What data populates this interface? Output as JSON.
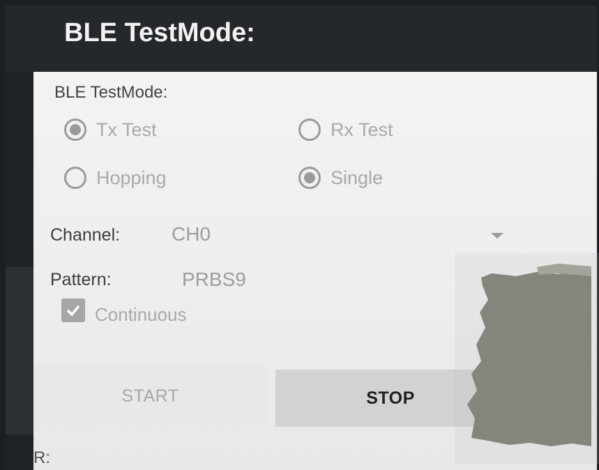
{
  "actionbar": {
    "title": "BLE TestMode:"
  },
  "panel": {
    "section_label": "BLE TestMode:"
  },
  "radios": {
    "tx_test": {
      "label": "Tx Test",
      "checked": true
    },
    "rx_test": {
      "label": "Rx Test",
      "checked": false
    },
    "hopping": {
      "label": "Hopping",
      "checked": false
    },
    "single": {
      "label": "Single",
      "checked": true
    }
  },
  "channel": {
    "label": "Channel:",
    "value": "CH0"
  },
  "pattern": {
    "label": "Pattern:",
    "value": "PRBS9"
  },
  "continuous": {
    "label": "Continuous",
    "checked": true
  },
  "buttons": {
    "start": "START",
    "stop": "STOP"
  },
  "result": {
    "label": "R:"
  },
  "colors": {
    "actionbar": "#24272b",
    "content_bg": "#f0f0f0",
    "disabled_text": "#a9a9a9",
    "stop_button": "#d2d2d2"
  },
  "icons": {
    "dropdown": "dropdown-arrow-icon",
    "check": "check-icon"
  }
}
